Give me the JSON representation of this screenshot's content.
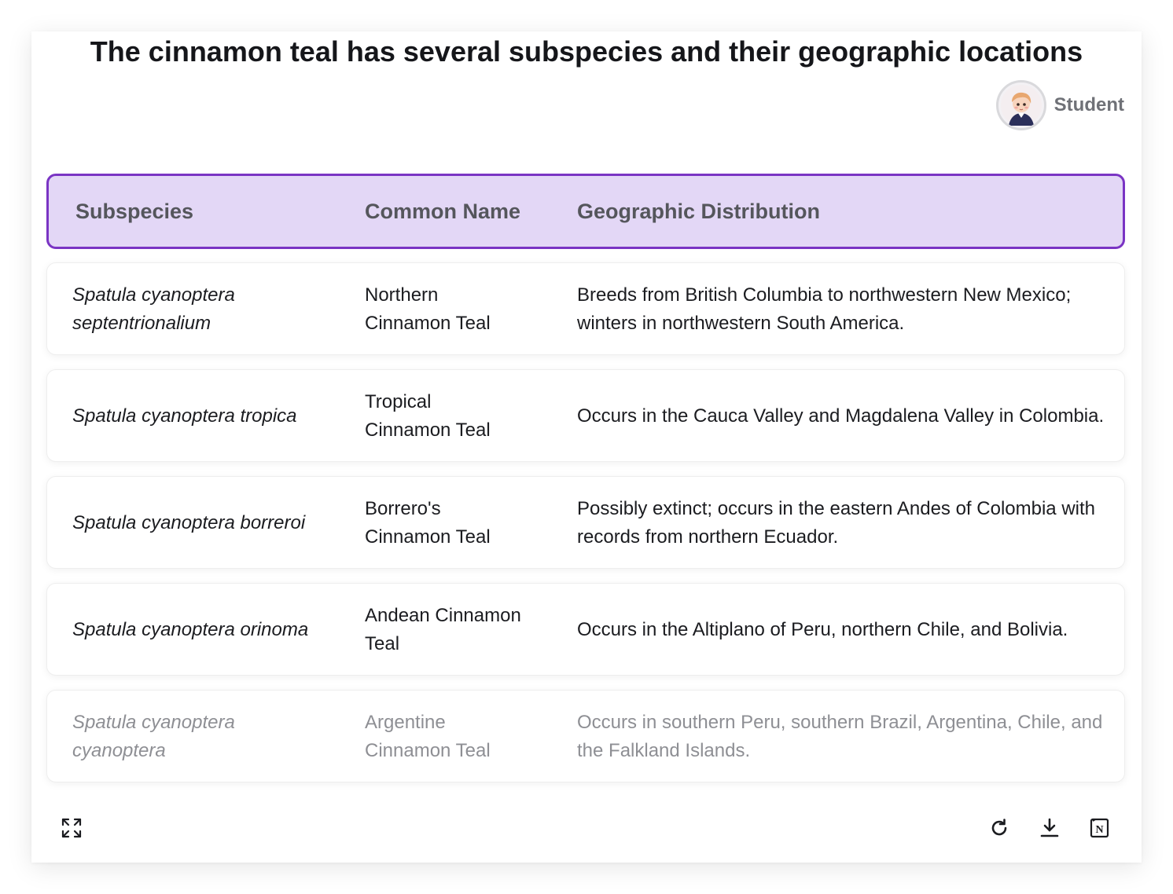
{
  "page": {
    "title": "The cinnamon teal has several subspecies and their geographic locations",
    "author": "Student"
  },
  "table": {
    "headers": [
      "Subspecies",
      "Common Name",
      "Geographic Distribution"
    ],
    "rows": [
      {
        "subspecies": "Spatula cyanoptera septentrionalium",
        "common_name": "Northern Cinnamon Teal",
        "distribution": "Breeds from British Columbia to northwestern New Mexico; winters in northwestern South America."
      },
      {
        "subspecies": "Spatula cyanoptera tropica",
        "common_name": "Tropical Cinnamon Teal",
        "distribution": "Occurs in the Cauca Valley and Magdalena Valley in Colombia."
      },
      {
        "subspecies": "Spatula cyanoptera borreroi",
        "common_name": "Borrero's Cinnamon Teal",
        "distribution": "Possibly extinct; occurs in the eastern Andes of Colombia with records from northern Ecuador."
      },
      {
        "subspecies": "Spatula cyanoptera orinoma",
        "common_name": "Andean Cinnamon Teal",
        "distribution": "Occurs in the Altiplano of Peru, northern Chile, and Bolivia."
      },
      {
        "subspecies": "Spatula cyanoptera cyanoptera",
        "common_name": "Argentine Cinnamon Teal",
        "distribution": "Occurs in southern Peru, southern Brazil, Argentina, Chile, and the Falkland Islands."
      }
    ]
  },
  "colors": {
    "header_bg": "#e3d7f6",
    "header_border": "#7a34c4",
    "text": "#1b1c20",
    "faded_text": "#8e8f94"
  },
  "icons": {
    "expand": "expand-icon",
    "refresh": "refresh-icon",
    "download": "download-icon",
    "notion": "notion-icon",
    "avatar": "avatar"
  }
}
